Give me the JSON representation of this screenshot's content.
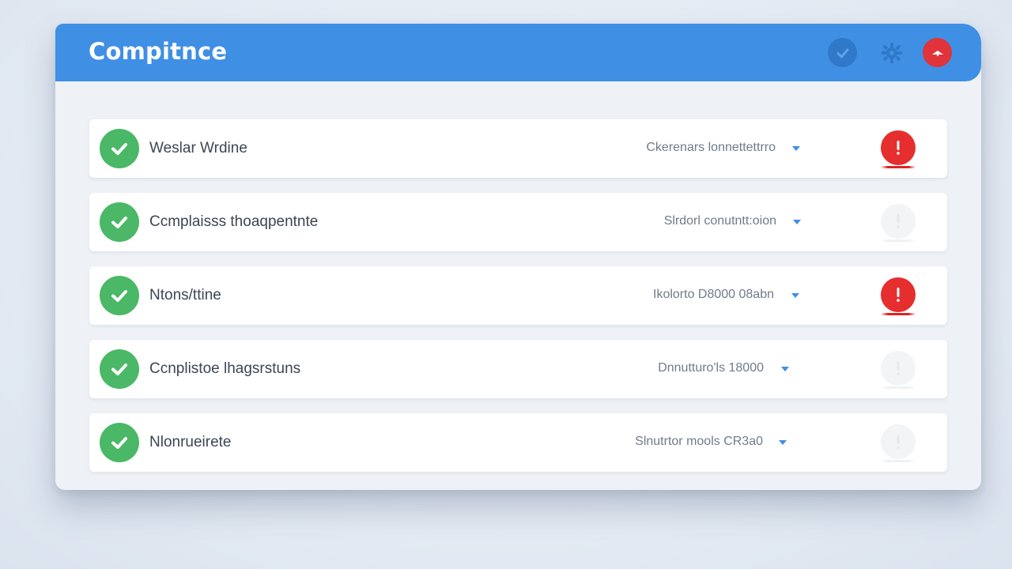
{
  "header": {
    "title": "Compitnce",
    "icons": [
      "check-circle-icon",
      "gear-icon",
      "alert-icon"
    ],
    "accent_color": "#3f8fe5"
  },
  "rows": [
    {
      "label": "Weslar Wrdine",
      "status": "Ckerenars lonnettettrro",
      "alert_active": true
    },
    {
      "label": "Ccmplaisss thoaqpentnte",
      "status": "Slrdorl conutntt:oion",
      "alert_active": false
    },
    {
      "label": "Ntons/ttine",
      "status": "Ikolorto D8000 08abn",
      "alert_active": true
    },
    {
      "label": "Ccnplistoe lhagsrstuns",
      "status": "Dnnutturo'ls 18000",
      "alert_active": false
    },
    {
      "label": "Nlonrueirete",
      "status": "Slnutrtor mools CR3a0",
      "alert_active": false
    }
  ],
  "colors": {
    "success": "#4ab866",
    "alert": "#e62e2e",
    "header_bg": "#3f8fe5"
  }
}
